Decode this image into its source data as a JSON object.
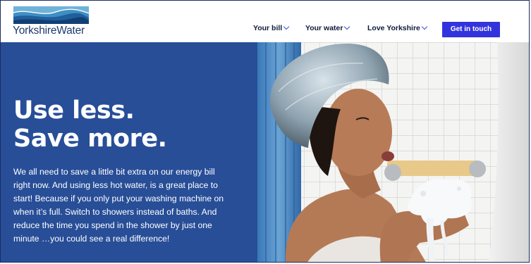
{
  "brand": {
    "name": "YorkshireWater"
  },
  "nav": {
    "items": [
      {
        "label": "Your bill"
      },
      {
        "label": "Your water"
      },
      {
        "label": "Love Yorkshire"
      }
    ],
    "cta_label": "Get in touch"
  },
  "hero": {
    "headline_line1": "Use less.",
    "headline_line2": "Save more.",
    "body": "We all need to save a little bit extra on our energy bill right now. And using less hot water, is a great place to start! Because if you only put your washing machine on when it’s full. Switch to showers instead of baths. And reduce the time you spend in the shower by just one minute …you could see a real difference!"
  },
  "colors": {
    "hero_panel": "#284e98",
    "cta_background": "#3333dd",
    "nav_text": "#0c1b36",
    "chevron": "#3b4fd6"
  },
  "icons": [
    "chevron-down-icon"
  ]
}
